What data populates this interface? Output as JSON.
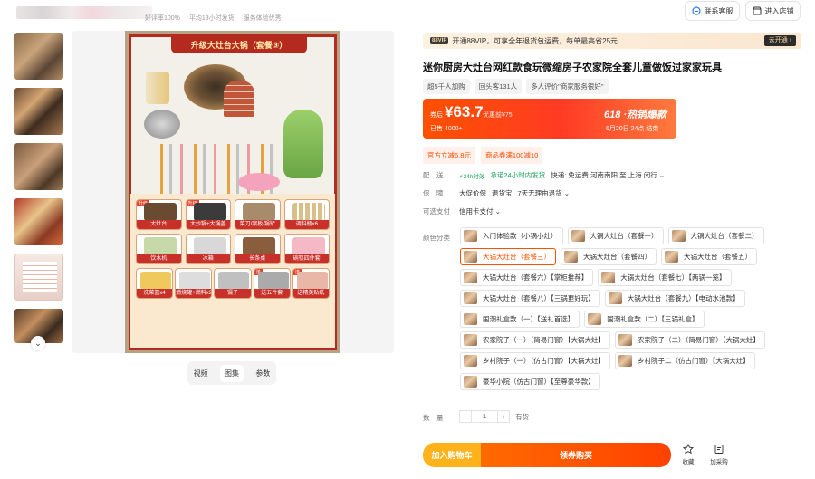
{
  "header": {
    "shop_stats": [
      "...",
      "好评率100%",
      "平均13小时发货",
      "服务体验优秀"
    ],
    "contact_btn": "联系客服",
    "enter_shop_btn": "进入店铺"
  },
  "gallery": {
    "poster_title": "升级大灶台大锅（套餐③）",
    "poster_items": [
      [
        "大灶台",
        "大炒锅+大锅盖",
        "菜刀/案板/锅铲",
        "调料瓶x6"
      ],
      [
        "饮水机",
        "冰箱",
        "长条桌",
        "碗筷四件套"
      ],
      [
        "洗菜篮x4",
        "燃烧罐+燃料x2",
        "镊子",
        "送五件套",
        "送精美贴纸"
      ]
    ],
    "badges": {
      "upgrade": "升级",
      "gift": "送"
    },
    "tabs": [
      "视频",
      "图集",
      "参数"
    ],
    "active_tab": "图集"
  },
  "vip": {
    "logo": "88VIP",
    "text": "开通88VIP，可享全年退货包运费，每单最高省25元",
    "cta": "去开通 ›"
  },
  "product": {
    "title": "迷你厨房大灶台网红款食玩微缩房子农家院全套儿童做饭过家家玩具",
    "chips": [
      "超5千人加购",
      "回头客131人",
      "多人评价\"商家服务很好\""
    ]
  },
  "price": {
    "label": "券后",
    "amount": "¥63.7",
    "original": "优惠前¥75",
    "sold": "已售 4000+",
    "promo": "618 ·热销爆款",
    "promo_end": "6月20日 24点 结束"
  },
  "coupons": [
    "官方立减6.8元",
    "商品券满100减10"
  ],
  "delivery": {
    "label": "配　送",
    "badge": "⚡24h时效",
    "promise": "承诺24小时内发货",
    "text": "快递: 免运费   河南南阳  至  上海 闵行 ⌄"
  },
  "guarantee": {
    "label": "保　障",
    "items": [
      "大促价保",
      "退货宝",
      "7天无理由退货 ⌄"
    ]
  },
  "payment": {
    "label": "可选支付",
    "value": "信用卡支付 ⌄"
  },
  "color_category": {
    "label": "颜色分类",
    "rows": [
      [
        "入门体验款（小锅小灶）",
        "大锅大灶台（套餐一）",
        "大锅大灶台（套餐二）"
      ],
      [
        "大锅大灶台（套餐三）",
        "大锅大灶台（套餐四）",
        "大锅大灶台（套餐五）"
      ],
      [
        "大锅大灶台（套餐六）【掌柜推荐】",
        "大锅大灶台（套餐七）【两锅一笼】"
      ],
      [
        "大锅大灶台（套餐八）【三锅更好玩】",
        "大锅大灶台（套餐九）【电动水池款】"
      ],
      [
        "国潮礼盒款（一）【送礼首选】",
        "国潮礼盒款（二）【三锅礼盒】"
      ],
      [
        "农家院子（一）（简易门窗）【大锅大灶】",
        "农家院子（二）（简易门窗）【大锅大灶】"
      ],
      [
        "乡村院子（一）（仿古门窗）【大锅大灶】",
        "乡村院子二（仿古门窗）【大锅大灶】"
      ],
      [
        "豪华小院（仿古门窗）【至尊豪华款】"
      ]
    ],
    "selected": "大锅大灶台（套餐三）"
  },
  "quantity": {
    "label": "数　量",
    "value": "1",
    "minus": "-",
    "plus": "+",
    "stock": "有货"
  },
  "actions": {
    "add_cart": "加入购物车",
    "buy_coupon": "领券购买",
    "favorite": "收藏",
    "purchase": "加采购"
  },
  "colors": {
    "accent": "#ff5000",
    "cart": "#ffb21a",
    "poster_red": "#b52a1f"
  }
}
